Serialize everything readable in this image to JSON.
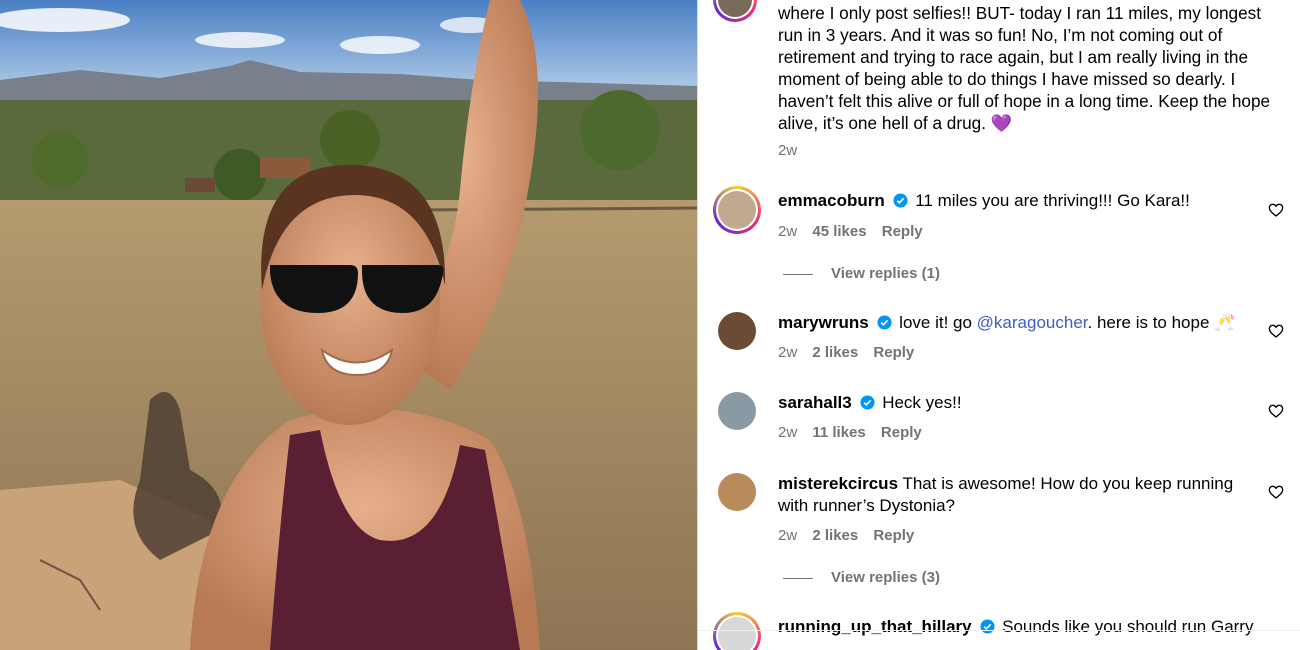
{
  "caption": {
    "text": "where I only post selfies!! BUT- today I ran 11 miles, my longest run in 3 years. And it was so fun! No, I’m not coming out of retirement and trying to race again, but I am really living in the moment of being able to do things I have missed so dearly. I haven’t felt this alive or full of hope in a long time. Keep the hope alive, it’s one hell of a drug.",
    "emoji": "💜",
    "time": "2w"
  },
  "comments": [
    {
      "user": "emmacoburn",
      "text": "11 miles you are thriving!!! Go Kara!!",
      "time": "2w",
      "likes": "45 likes",
      "reply": "Reply",
      "view_replies": "View replies (1)"
    },
    {
      "user": "marywruns",
      "text_before": "love it! go ",
      "mention": "@karagoucher",
      "text_after": ". here is to hope 🥂",
      "time": "2w",
      "likes": "2 likes",
      "reply": "Reply"
    },
    {
      "user": "sarahall3",
      "text": "Heck yes!!",
      "time": "2w",
      "likes": "11 likes",
      "reply": "Reply"
    },
    {
      "user": "misterekcircus",
      "text": "That is awesome! How do you keep running with runner’s Dystonia?",
      "time": "2w",
      "likes": "2 likes",
      "reply": "Reply",
      "view_replies": "View replies (3)"
    },
    {
      "user": "running_up_that_hillary",
      "text": "Sounds like you should run Garry"
    }
  ],
  "icons": {
    "like": "heart-outline-icon",
    "verified": "verified-badge-icon"
  },
  "colors": {
    "link": "#3d5ec8",
    "verified": "#0095f6",
    "muted": "#737373"
  }
}
